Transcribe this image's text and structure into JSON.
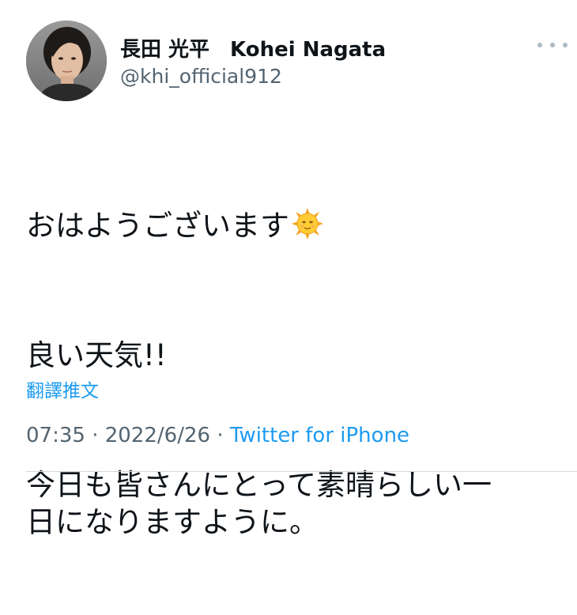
{
  "tweet": {
    "display_name": "長田 光平　Kohei Nagata",
    "handle": "@khi_official912",
    "lines": {
      "line1": "おはようございます",
      "line1_emoji": "sun-with-face",
      "line2": "良い天気!!",
      "line3": "今日も皆さんにとって素晴らしい一\n日になりますように。"
    },
    "translate_label": "翻譯推文",
    "time": "07:35",
    "separator": " · ",
    "date": "2022/6/26",
    "separator2": " · ",
    "source": "Twitter for iPhone"
  },
  "colors": {
    "accent": "#1d9bf0",
    "text": "#0f1419",
    "muted": "#536471",
    "more_dots": "#aab8c2"
  },
  "icons": {
    "more": "more-horizontal-icon",
    "emoji": "sun-with-face-icon"
  }
}
